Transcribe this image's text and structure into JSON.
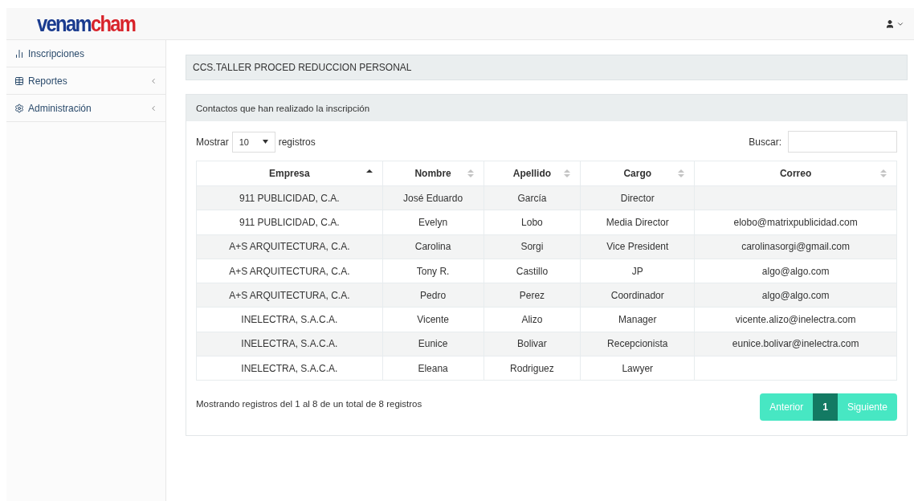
{
  "logo": {
    "first": "venam",
    "second": "cham"
  },
  "sidebar": {
    "items": [
      {
        "label": "Inscripciones",
        "has_submenu": false
      },
      {
        "label": "Reportes",
        "has_submenu": true
      },
      {
        "label": "Administración",
        "has_submenu": true
      }
    ]
  },
  "title_panel": {
    "title": "CCS.TALLER PROCED REDUCCION PERSONAL"
  },
  "contacts_panel": {
    "heading": "Contactos que han realizado la inscripción",
    "length": {
      "prefix": "Mostrar",
      "value": "10",
      "suffix": "registros"
    },
    "search": {
      "label": "Buscar:"
    },
    "table": {
      "columns": [
        {
          "label": "Empresa",
          "sorted": true
        },
        {
          "label": "Nombre",
          "sorted": false
        },
        {
          "label": "Apellido",
          "sorted": false
        },
        {
          "label": "Cargo",
          "sorted": false
        },
        {
          "label": "Correo",
          "sorted": false
        }
      ],
      "rows": [
        [
          "911 PUBLICIDAD, C.A.",
          "José Eduardo",
          "García",
          "Director",
          ""
        ],
        [
          "911 PUBLICIDAD, C.A.",
          "Evelyn",
          "Lobo",
          "Media Director",
          "elobo@matrixpublicidad.com"
        ],
        [
          "A+S ARQUITECTURA, C.A.",
          "Carolina",
          "Sorgi",
          "Vice President",
          "carolinasorgi@gmail.com"
        ],
        [
          "A+S ARQUITECTURA, C.A.",
          "Tony R.",
          "Castillo",
          "JP",
          "algo@algo.com"
        ],
        [
          "A+S ARQUITECTURA, C.A.",
          "Pedro",
          "Perez",
          "Coordinador",
          "algo@algo.com"
        ],
        [
          "INELECTRA, S.A.C.A.",
          "Vicente",
          "Alizo",
          "Manager",
          "vicente.alizo@inelectra.com"
        ],
        [
          "INELECTRA, S.A.C.A.",
          "Eunice",
          "Bolivar",
          "Recepcionista",
          "eunice.bolivar@inelectra.com"
        ],
        [
          "INELECTRA, S.A.C.A.",
          "Eleana",
          "Rodriguez",
          "Lawyer",
          ""
        ]
      ]
    },
    "info": "Mostrando registros del 1 al 8 de un total de 8 registros",
    "pagination": [
      {
        "label": "Anterior",
        "selected": false
      },
      {
        "label": "1",
        "selected": true
      },
      {
        "label": "Siguiente",
        "selected": false
      }
    ]
  }
}
